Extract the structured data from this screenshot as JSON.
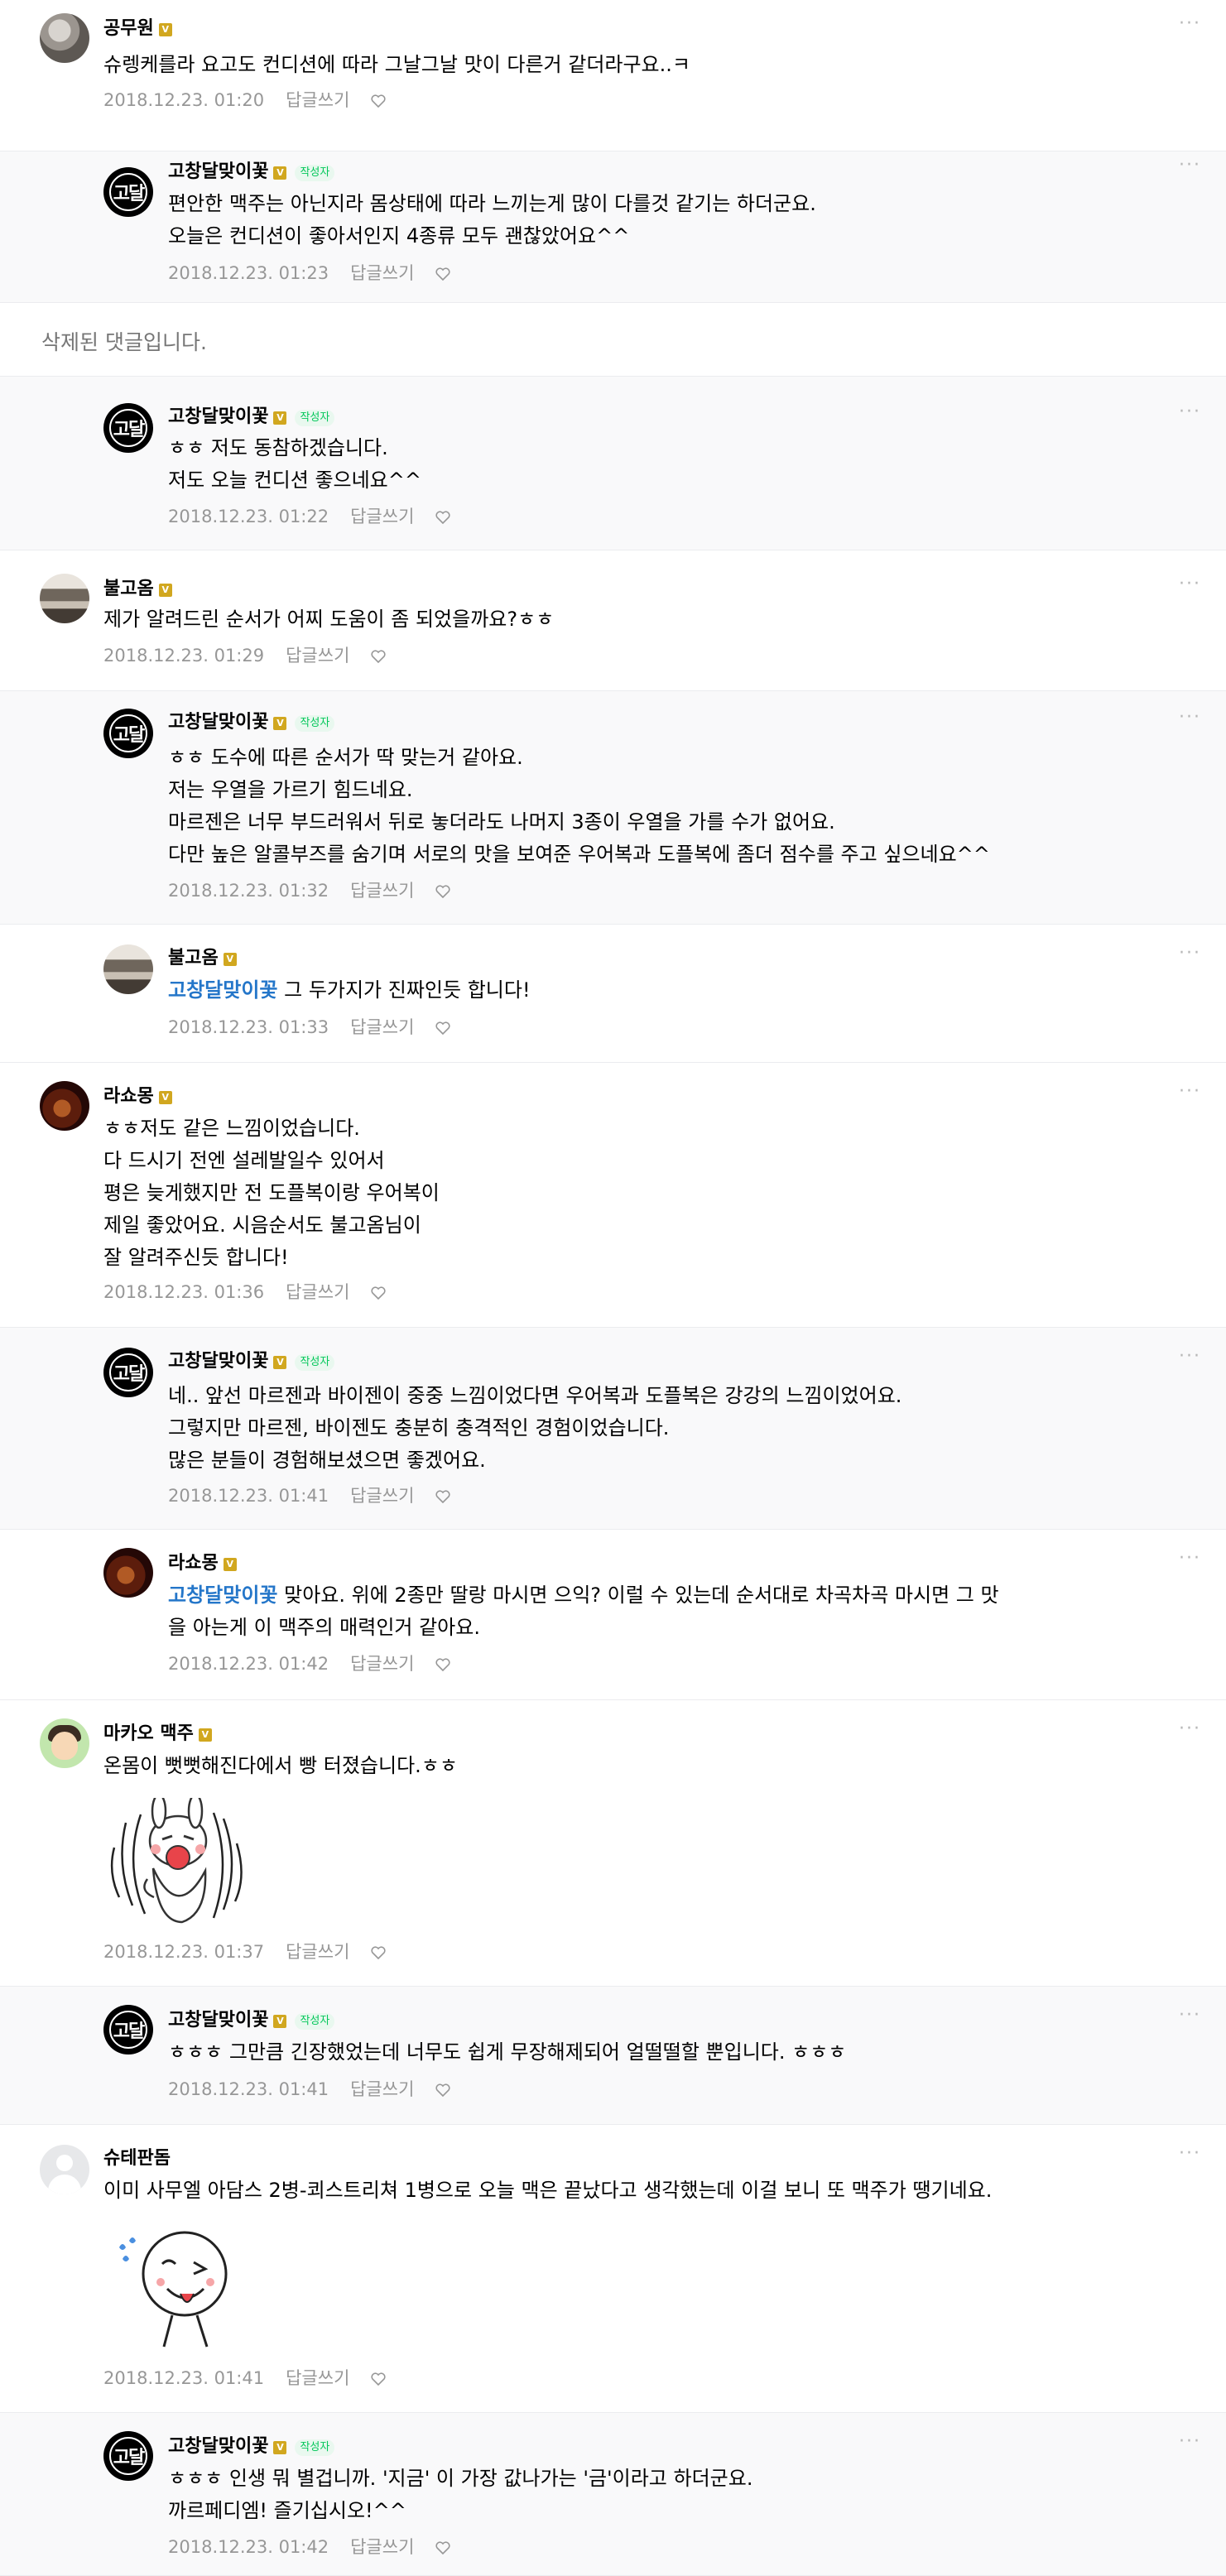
{
  "comments": [
    {
      "id": "c1",
      "name": "공무원",
      "text": "슈렝케를라 요고도 컨디션에 따라 그날그날 맛이 다른거 같더라구요..ㅋ",
      "time": "2018.12.23. 01:20",
      "reply": "답글쓰기"
    },
    {
      "id": "c2",
      "name": "고창달맞이꽃",
      "author_badge": "작성자",
      "text": "편안한 맥주는 아닌지라 몸상태에 따라 느끼는게 많이 다를것 같기는 하더군요.\n오늘은 컨디션이 좋아서인지 4종류 모두 괜찮았어요^^",
      "time": "2018.12.23. 01:23",
      "reply": "답글쓰기"
    },
    {
      "id": "deleted",
      "text": "삭제된 댓글입니다."
    },
    {
      "id": "c3",
      "name": "고창달맞이꽃",
      "author_badge": "작성자",
      "text": "ㅎㅎ 저도 동참하겠습니다.\n저도 오늘 컨디션 좋으네요^^",
      "time": "2018.12.23. 01:22",
      "reply": "답글쓰기"
    },
    {
      "id": "c4",
      "name": "불고옴",
      "text": "제가 알려드린 순서가 어찌 도움이 좀 되었을까요?ㅎㅎ",
      "time": "2018.12.23. 01:29",
      "reply": "답글쓰기"
    },
    {
      "id": "c5",
      "name": "고창달맞이꽃",
      "author_badge": "작성자",
      "text": "ㅎㅎ 도수에 따른 순서가 딱 맞는거 같아요.\n저는 우열을 가르기 힘드네요.\n마르젠은 너무 부드러워서 뒤로 놓더라도 나머지 3종이 우열을 가를 수가 없어요.\n다만 높은 알콜부즈를 숨기며 서로의 맛을 보여준 우어복과 도플복에 좀더 점수를 주고 싶으네요^^",
      "time": "2018.12.23. 01:32",
      "reply": "답글쓰기"
    },
    {
      "id": "c6",
      "name": "불고옴",
      "mention": "고창달맞이꽃",
      "text": " 그 두가지가 진짜인듯 합니다!",
      "time": "2018.12.23. 01:33",
      "reply": "답글쓰기"
    },
    {
      "id": "c7",
      "name": "라쇼몽",
      "text": "ㅎㅎ저도 같은 느낌이었습니다.\n다 드시기 전엔 설레발일수 있어서\n평은 늦게했지만 전 도플복이랑 우어복이\n제일 좋았어요. 시음순서도 불고옴님이\n잘 알려주신듯 합니다!",
      "time": "2018.12.23. 01:36",
      "reply": "답글쓰기"
    },
    {
      "id": "c8",
      "name": "고창달맞이꽃",
      "author_badge": "작성자",
      "text": "네.. 앞선 마르젠과 바이젠이 중중 느낌이었다면 우어복과 도플복은 강강의 느낌이었어요.\n그렇지만 마르젠, 바이젠도 충분히 충격적인 경험이었습니다.\n많은 분들이 경험해보셨으면 좋겠어요.",
      "time": "2018.12.23. 01:41",
      "reply": "답글쓰기"
    },
    {
      "id": "c9",
      "name": "라쇼몽",
      "mention": "고창달맞이꽃",
      "text": " 맞아요. 위에 2종만 딸랑 마시면 으익? 이럴 수 있는데 순서대로 차곡차곡 마시면 그 맛\n을 아는게 이 맥주의 매력인거 같아요.",
      "time": "2018.12.23. 01:42",
      "reply": "답글쓰기"
    },
    {
      "id": "c10",
      "name": "마카오 맥주",
      "text": "온몸이 뻣뻣해진다에서 빵 터졌습니다.ㅎㅎ",
      "time": "2018.12.23. 01:37",
      "reply": "답글쓰기"
    },
    {
      "id": "c11",
      "name": "고창달맞이꽃",
      "author_badge": "작성자",
      "text": "ㅎㅎㅎ 그만큼 긴장했었는데 너무도 쉽게 무장해제되어 얼떨떨할 뿐입니다. ㅎㅎㅎ",
      "time": "2018.12.23. 01:41",
      "reply": "답글쓰기"
    },
    {
      "id": "c12",
      "name": "슈테판돔",
      "text": "이미 사무엘 아담스 2병-쾨스트리쳐 1병으로 오늘 맥은 끝났다고 생각했는데 이걸 보니 또 맥주가 땡기네요.",
      "time": "2018.12.23. 01:41",
      "reply": "답글쓰기"
    },
    {
      "id": "c13",
      "name": "고창달맞이꽃",
      "author_badge": "작성자",
      "text": "ㅎㅎㅎ 인생 뭐 별겁니까. '지금' 이 가장 값나가는 '금'이라고 하더군요.\n까르페디엠! 즐기십시오!^^",
      "time": "2018.12.23. 01:42",
      "reply": "답글쓰기"
    }
  ],
  "avatar_logo_text": "고달",
  "icons": {
    "more": "more-dots-icon",
    "like": "heart-icon",
    "verified": "v-badge-icon"
  },
  "colors": {
    "reply_bg": "#f9f9fa",
    "mention": "#2476c9",
    "author_badge": "#03c75a",
    "meta": "#979797"
  }
}
